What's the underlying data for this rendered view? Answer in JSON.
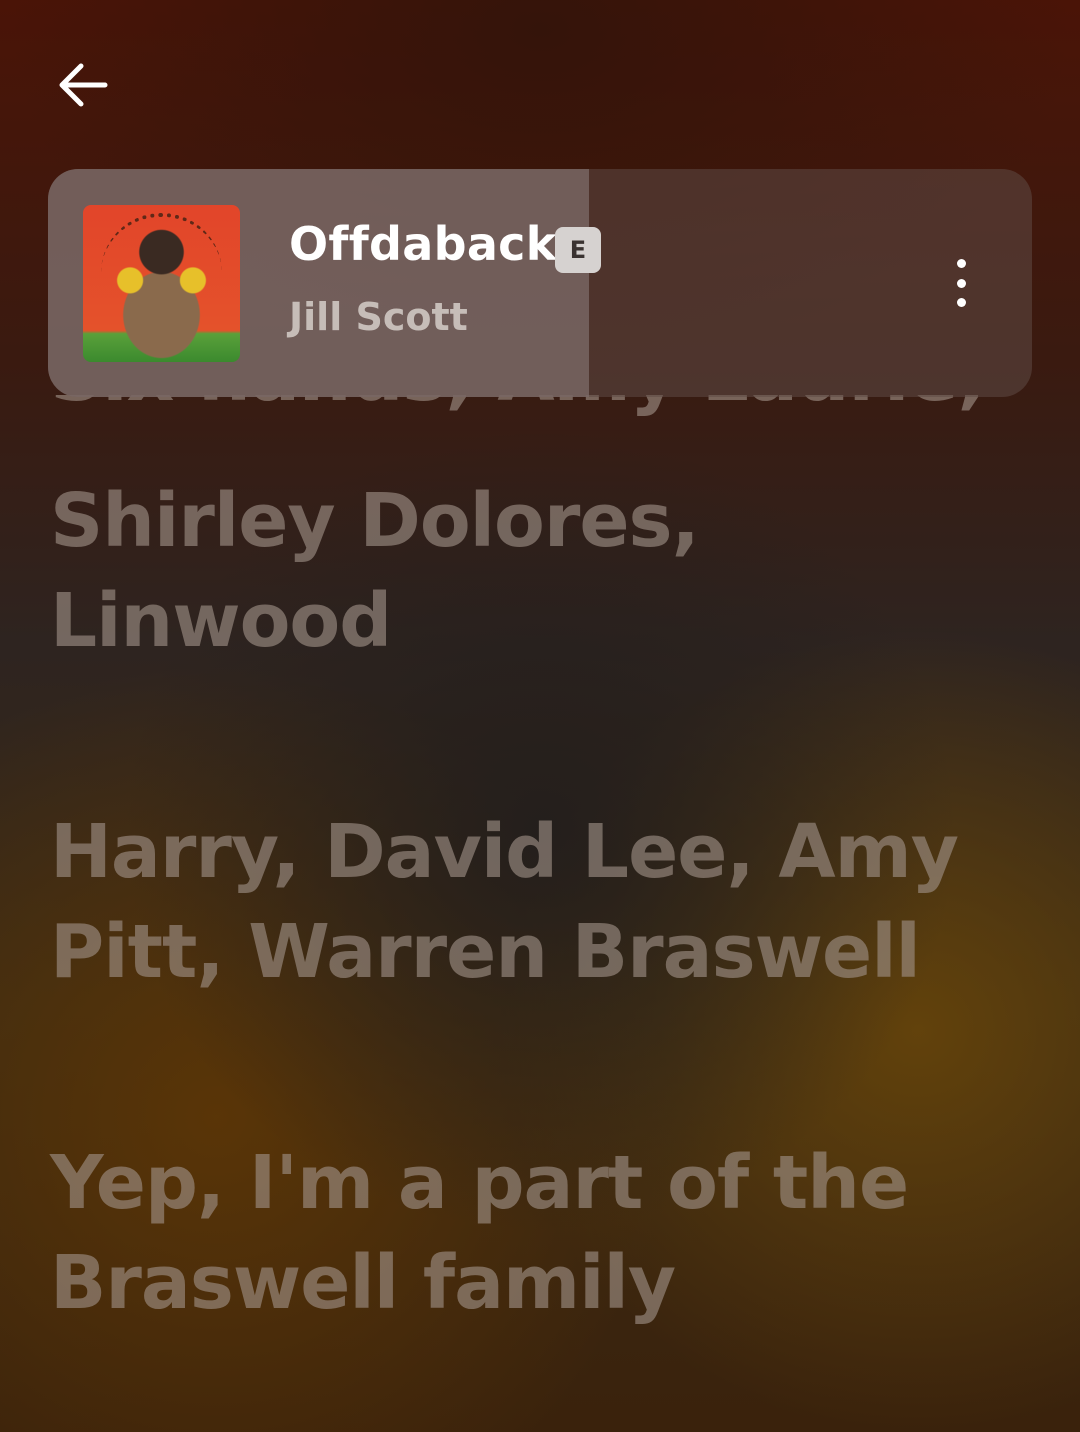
{
  "header": {
    "back_icon": "arrow-left-icon"
  },
  "now_playing": {
    "title": "Offdaback",
    "explicit_badge": "E",
    "artist": "Jill Scott",
    "more_icon": "more-vertical-icon",
    "progress": 0.55
  },
  "lyrics": {
    "partial_line": "Six hands, Amy Laurie,",
    "lines": [
      "Shirley Dolores,",
      "Linwood",
      "Harry, David Lee, Amy",
      "Pitt, Warren Braswell",
      "Yep, I'm a part of the",
      "Braswell family"
    ]
  }
}
